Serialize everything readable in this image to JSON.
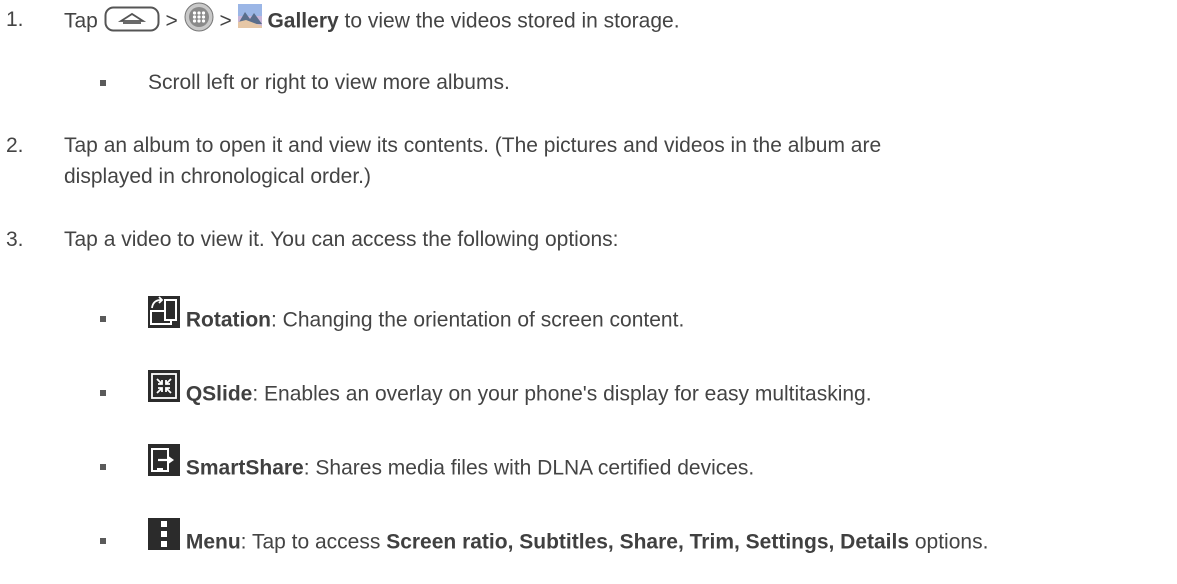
{
  "steps": [
    {
      "number": "1.",
      "prefix": "Tap",
      "sep1": ">",
      "sep2": ">",
      "bold": "Gallery",
      "suffix": "to view the videos stored in storage.",
      "icons": [
        "home-key-icon",
        "apps-icon",
        "gallery-icon"
      ],
      "bullet": "Scroll left or right to view more albums."
    },
    {
      "number": "2.",
      "line1": "Tap an album to open it and view its contents. (The pictures and videos in the album are",
      "line2": "displayed in chronological order.)"
    },
    {
      "number": "3.",
      "text": "Tap a video to view it. You can access the following options:"
    }
  ],
  "options": [
    {
      "icon": "rotation-icon",
      "name": "Rotation",
      "desc": ": Changing the orientation of screen content."
    },
    {
      "icon": "qslide-icon",
      "name": "QSlide",
      "desc": ": Enables an overlay on your phone's display for easy multitasking."
    },
    {
      "icon": "smartshare-icon",
      "name": "SmartShare",
      "desc": ": Shares media files with DLNA certified devices."
    },
    {
      "icon": "menu-icon",
      "name": "Menu",
      "desc": ": Tap to access ",
      "bold2": "Screen ratio, Subtitles, Share, Trim, Settings, Details",
      "tail": " options."
    }
  ]
}
